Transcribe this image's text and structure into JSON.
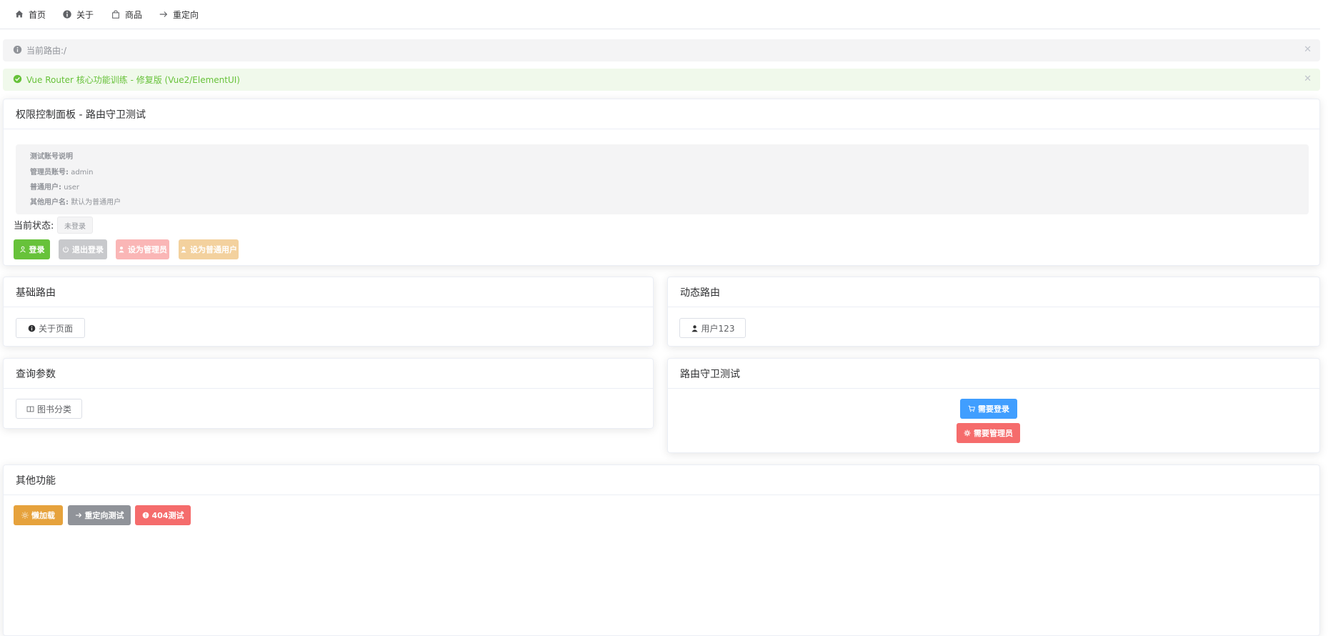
{
  "nav": {
    "items": [
      {
        "label": "首页",
        "icon": "home-icon"
      },
      {
        "label": "关于",
        "icon": "info-icon"
      },
      {
        "label": "商品",
        "icon": "bag-icon"
      },
      {
        "label": "重定向",
        "icon": "arrow-right-icon"
      }
    ]
  },
  "alerts": {
    "route_info": "当前路由:/",
    "success": "Vue Router 核心功能训练 - 修复版 (Vue2/ElementUI)"
  },
  "permission_panel": {
    "title": "权限控制面板 - 路由守卫测试",
    "info_title": "测试账号说明",
    "admin_label": "管理员账号:",
    "admin_value": "admin",
    "user_label": "普通用户:",
    "user_value": "user",
    "other_label": "其他用户名:",
    "other_value": "默认为普通用户",
    "status_label": "当前状态:",
    "status_value": "未登录",
    "buttons": {
      "login": "登录",
      "logout": "退出登录",
      "set_admin": "设为管理员",
      "set_user": "设为普通用户"
    }
  },
  "basic_routes": {
    "title": "基础路由",
    "about_button": "关于页面"
  },
  "dynamic_routes": {
    "title": "动态路由",
    "user_button": "用户123"
  },
  "query_params": {
    "title": "查询参数",
    "books_button": "图书分类"
  },
  "guard_test": {
    "title": "路由守卫测试",
    "need_login": "需要登录",
    "need_admin": "需要管理员"
  },
  "other": {
    "title": "其他功能",
    "lazy": "懒加载",
    "redirect": "重定向测试",
    "not_found": "404测试"
  },
  "colors": {
    "success": "#67c23a",
    "info": "#c8c9cc",
    "danger_light": "#fab6b6",
    "warning_light": "#f3d19e",
    "primary": "#409eff",
    "danger": "#f56c6c",
    "warning": "#e6a23c",
    "gray": "#909399"
  }
}
